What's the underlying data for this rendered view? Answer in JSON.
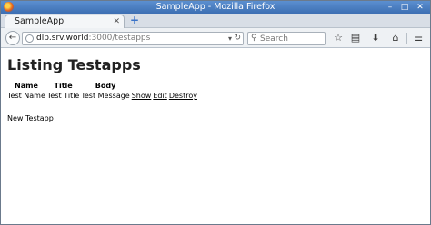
{
  "window": {
    "title": "SampleApp - Mozilla Firefox",
    "minimize_glyph": "–",
    "maximize_glyph": "□",
    "close_glyph": "✕"
  },
  "tabs": [
    {
      "label": "SampleApp",
      "close_glyph": "✕"
    }
  ],
  "new_tab_glyph": "+",
  "navbar": {
    "url_host": "dlp.srv.world",
    "url_rest": ":3000/testapps",
    "search_placeholder": "Search",
    "icons": [
      "back-icon",
      "globe-icon",
      "dropdown-icon",
      "reload-icon",
      "search-icon",
      "bookmark-star-icon",
      "reading-list-icon",
      "download-icon",
      "home-icon",
      "menu-icon"
    ]
  },
  "page": {
    "heading": "Listing Testapps",
    "columns": [
      "Name",
      "Title",
      "Body"
    ],
    "rows": [
      {
        "name": "Test Name",
        "title": "Test Title",
        "body": "Test Message",
        "actions": [
          "Show",
          "Edit",
          "Destroy"
        ]
      }
    ],
    "new_link": "New Testapp"
  }
}
